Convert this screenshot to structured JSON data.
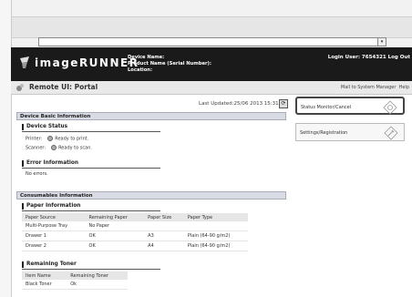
{
  "browser": {
    "address": "",
    "dropdown_glyph": "▾"
  },
  "header": {
    "logo": "imageRUNNER",
    "device_name_label": "Device Name:",
    "product_name_label": "Product Name (Serial Number):",
    "location_label": "Location:",
    "login_user": "Login User: 7654321 Log Out"
  },
  "titlebar": {
    "title": "Remote UI: Portal",
    "mail_link": "Mail to System Manager",
    "help_link": "Help"
  },
  "status": {
    "last_updated": "Last Updated:25/06 2013 15:31",
    "refresh_glyph": "⟳"
  },
  "device_basic": {
    "heading": "Device Basic Information",
    "device_status_heading": "Device Status",
    "printer_label": "Printer:",
    "printer_status": "Ready to print.",
    "scanner_label": "Scanner:",
    "scanner_status": "Ready to scan.",
    "error_heading": "Error Information",
    "error_text": "No errors."
  },
  "consumables": {
    "heading": "Consumables Information",
    "paper_heading": "Paper Information",
    "paper_columns": [
      "Paper Source",
      "Remaining Paper",
      "Paper Size",
      "Paper Type"
    ],
    "paper_rows": [
      [
        "Multi-Purpose Tray",
        "No Paper",
        "",
        ""
      ],
      [
        "Drawer 1",
        "OK",
        "A3",
        "Plain (64-90 g/m2)"
      ],
      [
        "Drawer 2",
        "OK",
        "A4",
        "Plain (64-90 g/m2)"
      ]
    ],
    "toner_heading": "Remaining Toner",
    "toner_columns": [
      "Item Name",
      "Remaining Toner"
    ],
    "toner_rows": [
      [
        "Black Toner",
        "Ok"
      ]
    ]
  },
  "menu": {
    "status_monitor": "Status Monitor/Cancel",
    "settings": "Settings/Registration"
  },
  "colors": {
    "header_bg": "#1a1a1a",
    "section_bg": "#d8dbe3"
  }
}
